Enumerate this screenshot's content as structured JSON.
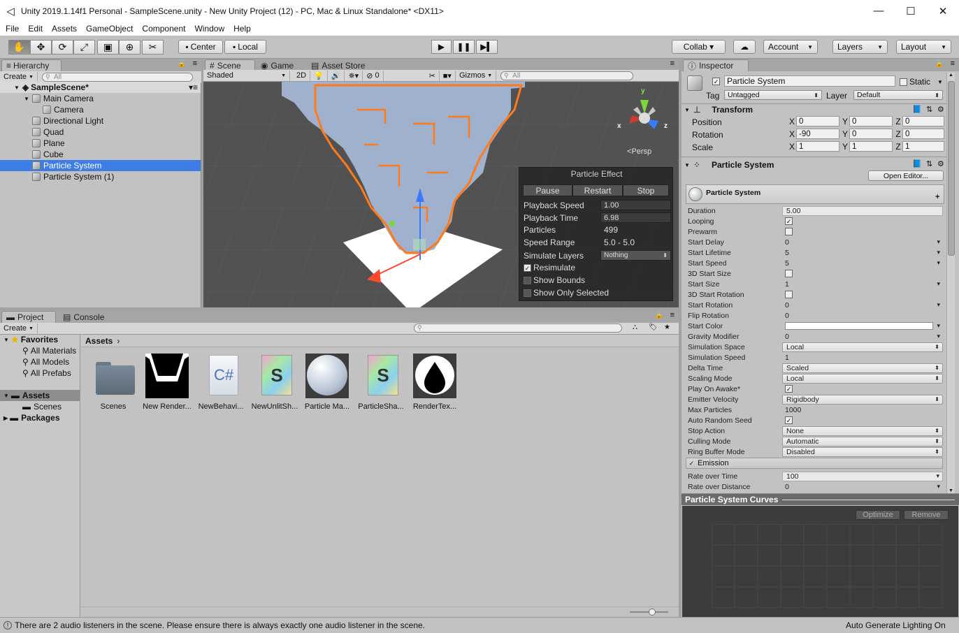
{
  "window": {
    "title": "Unity 2019.1.14f1 Personal - SampleScene.unity - New Unity Project (12) - PC, Mac & Linux Standalone* <DX11>"
  },
  "menu": [
    "File",
    "Edit",
    "Assets",
    "GameObject",
    "Component",
    "Window",
    "Help"
  ],
  "toolbar": {
    "center_label": "Center",
    "local_label": "Local",
    "collab_label": "Collab ▾",
    "account_label": "Account",
    "layers_label": "Layers",
    "layout_label": "Layout"
  },
  "hierarchy": {
    "tab": "Hierarchy",
    "create": "Create",
    "search_placeholder": "All",
    "scene_name": "SampleScene*",
    "items": [
      {
        "label": "Main Camera"
      },
      {
        "label": "Camera"
      },
      {
        "label": "Directional Light"
      },
      {
        "label": "Quad"
      },
      {
        "label": "Plane"
      },
      {
        "label": "Cube"
      },
      {
        "label": "Particle System"
      },
      {
        "label": "Particle System (1)"
      }
    ]
  },
  "scene_view": {
    "tabs": [
      "Scene",
      "Game",
      "Asset Store"
    ],
    "shading": "Shaded",
    "mode_2d": "2D",
    "fx_count": "0",
    "gizmos": "Gizmos",
    "search_placeholder": "All",
    "persp": "Persp",
    "axis_labels": {
      "y": "y",
      "x": "x",
      "z": "z"
    }
  },
  "particle_effect": {
    "title": "Particle Effect",
    "buttons": [
      "Pause",
      "Restart",
      "Stop"
    ],
    "playback_speed_label": "Playback Speed",
    "playback_speed": "1.00",
    "playback_time_label": "Playback Time",
    "playback_time": "6.98",
    "particles_label": "Particles",
    "particles": "499",
    "speed_range_label": "Speed Range",
    "speed_range": "5.0 - 5.0",
    "simulate_layers_label": "Simulate Layers",
    "simulate_layers": "Nothing",
    "resimulate": "Resimulate",
    "show_bounds": "Show Bounds",
    "show_only_selected": "Show Only Selected"
  },
  "inspector": {
    "tab": "Inspector",
    "object_name": "Particle System",
    "static_label": "Static",
    "tag_label": "Tag",
    "tag_value": "Untagged",
    "layer_label": "Layer",
    "layer_value": "Default",
    "transform": {
      "title": "Transform",
      "position_label": "Position",
      "position": [
        "0",
        "0",
        "0"
      ],
      "rotation_label": "Rotation",
      "rotation": [
        "-90",
        "0",
        "0"
      ],
      "scale_label": "Scale",
      "scale": [
        "1",
        "1",
        "1"
      ]
    },
    "particle_component_title": "Particle System",
    "open_editor": "Open Editor...",
    "module_title": "Particle System",
    "emission_title": "Emission",
    "curves_title": "Particle System Curves",
    "optimize": "Optimize",
    "remove": "Remove"
  },
  "ps_props": [
    {
      "k": "Duration",
      "v": "5.00",
      "t": "fld"
    },
    {
      "k": "Looping",
      "v": "✓",
      "t": "chk"
    },
    {
      "k": "Prewarm",
      "v": "",
      "t": "chk"
    },
    {
      "k": "Start Delay",
      "v": "0",
      "t": "plain",
      "arr": true
    },
    {
      "k": "Start Lifetime",
      "v": "5",
      "t": "plain",
      "arr": true
    },
    {
      "k": "Start Speed",
      "v": "5",
      "t": "plain",
      "arr": true
    },
    {
      "k": "3D Start Size",
      "v": "",
      "t": "chk"
    },
    {
      "k": "Start Size",
      "v": "1",
      "t": "plain",
      "arr": true
    },
    {
      "k": "3D Start Rotation",
      "v": "",
      "t": "chk"
    },
    {
      "k": "Start Rotation",
      "v": "0",
      "t": "plain",
      "arr": true
    },
    {
      "k": "Flip Rotation",
      "v": "0",
      "t": "plain"
    },
    {
      "k": "Start Color",
      "v": "",
      "t": "color",
      "arr": true
    },
    {
      "k": "Gravity Modifier",
      "v": "0",
      "t": "plain",
      "arr": true
    },
    {
      "k": "Simulation Space",
      "v": "Local",
      "t": "drop"
    },
    {
      "k": "Simulation Speed",
      "v": "1",
      "t": "plain"
    },
    {
      "k": "Delta Time",
      "v": "Scaled",
      "t": "drop"
    },
    {
      "k": "Scaling Mode",
      "v": "Local",
      "t": "drop"
    },
    {
      "k": "Play On Awake*",
      "v": "✓",
      "t": "chk"
    },
    {
      "k": "Emitter Velocity",
      "v": "Rigidbody",
      "t": "drop"
    },
    {
      "k": "Max Particles",
      "v": "1000",
      "t": "plain"
    },
    {
      "k": "Auto Random Seed",
      "v": "✓",
      "t": "chk"
    },
    {
      "k": "Stop Action",
      "v": "None",
      "t": "drop"
    },
    {
      "k": "Culling Mode",
      "v": "Automatic",
      "t": "drop"
    },
    {
      "k": "Ring Buffer Mode",
      "v": "Disabled",
      "t": "drop"
    }
  ],
  "emission_props": [
    {
      "k": "Rate over Time",
      "v": "100",
      "t": "fld",
      "arr": true
    },
    {
      "k": "Rate over Distance",
      "v": "0",
      "t": "plain",
      "arr": true
    }
  ],
  "project": {
    "tabs": [
      "Project",
      "Console"
    ],
    "create": "Create",
    "favorites": "Favorites",
    "fav_items": [
      "All Materials",
      "All Models",
      "All Prefabs"
    ],
    "assets_root": "Assets",
    "assets_children": [
      "Scenes"
    ],
    "packages": "Packages",
    "breadcrumb": "Assets",
    "assets": [
      {
        "label": "Scenes",
        "kind": "folder"
      },
      {
        "label": "New Render...",
        "kind": "rendermask"
      },
      {
        "label": "NewBehavi...",
        "kind": "csharp"
      },
      {
        "label": "NewUnlitSh...",
        "kind": "shader"
      },
      {
        "label": "Particle Ma...",
        "kind": "material"
      },
      {
        "label": "ParticleSha...",
        "kind": "shader"
      },
      {
        "label": "RenderTex...",
        "kind": "drop"
      }
    ]
  },
  "status": {
    "message": "There are 2 audio listeners in the scene. Please ensure there is always exactly one audio listener in the scene.",
    "lighting": "Auto Generate Lighting On"
  },
  "colors": {
    "selection": "#3e7ce6",
    "outline": "#ff7a1a",
    "particles": "#9fb1cc"
  }
}
